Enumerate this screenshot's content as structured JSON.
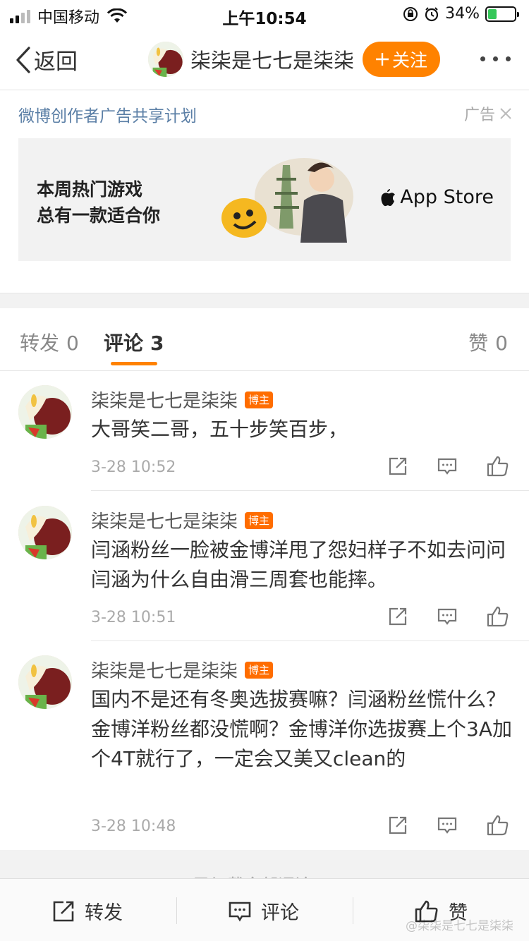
{
  "status_bar": {
    "carrier": "中国移动",
    "time": "上午10:54",
    "battery": "34%",
    "battery_level": 0.34
  },
  "nav": {
    "back_label": "返回",
    "user_name": "柒柒是七七是柒柒",
    "follow_label": "关注"
  },
  "ad": {
    "title": "微博创作者广告共享计划",
    "label": "广告",
    "line1": "本周热门游戏",
    "line2": "总有一款适合你",
    "store_label": "App Store"
  },
  "tabs": {
    "repost": {
      "label": "转发",
      "count": "0"
    },
    "comment": {
      "label": "评论",
      "count": "3"
    },
    "like": {
      "label": "赞",
      "count": "0"
    }
  },
  "comments": [
    {
      "author": "柒柒是七七是柒柒",
      "badge": "博主",
      "text": "大哥笑二哥，五十步笑百步，",
      "time": "3-28 10:52"
    },
    {
      "author": "柒柒是七七是柒柒",
      "badge": "博主",
      "text": "闫涵粉丝一脸被金博洋甩了怨妇样子不如去问问闫涵为什么自由滑三周套也能摔。",
      "time": "3-28 10:51"
    },
    {
      "author": "柒柒是七七是柒柒",
      "badge": "博主",
      "text": "国内不是还有冬奥选拔赛嘛？闫涵粉丝慌什么？金博洋粉丝都没慌啊？金博洋你选拔赛上个3A加个4T就行了，一定会又美又clean的",
      "time": "3-28 10:48"
    }
  ],
  "load_more": "已加载全部评论",
  "toolbar": {
    "repost_label": "转发",
    "comment_label": "评论",
    "like_label": "赞"
  },
  "watermark": "@柒柒是七七是柒柒",
  "colors": {
    "accent": "#ff8200",
    "badge": "#ff6d00",
    "link": "#5b7fa6"
  }
}
